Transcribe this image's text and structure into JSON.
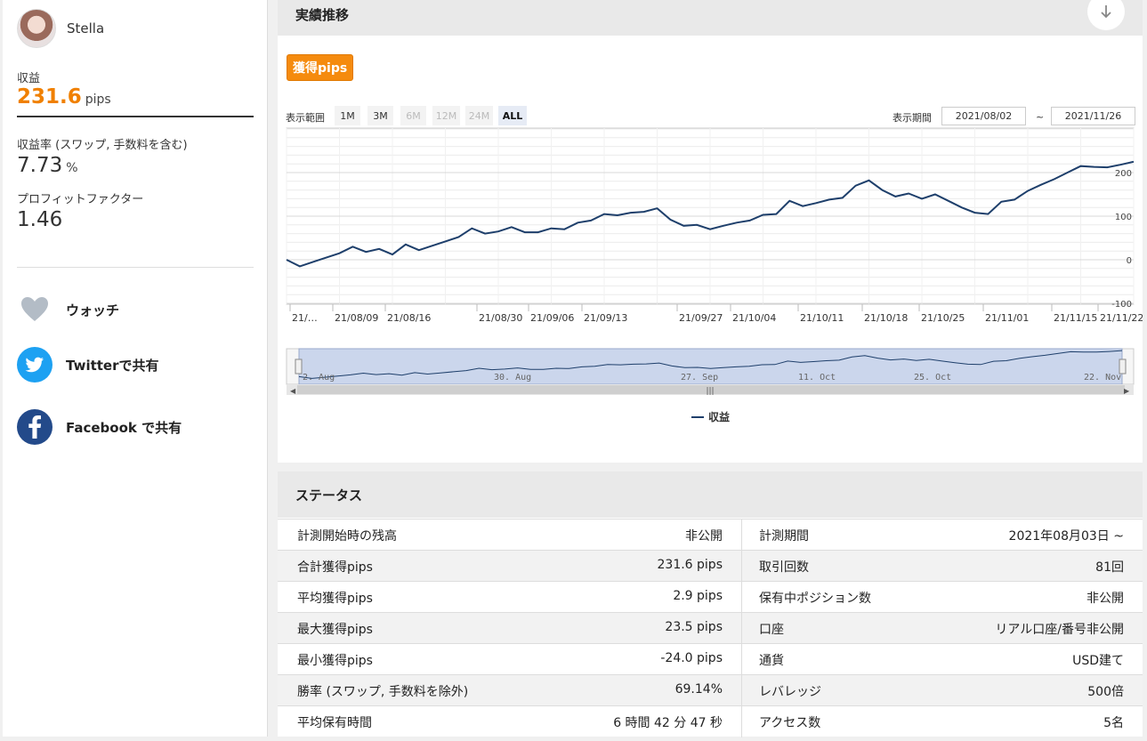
{
  "profile": {
    "name": "Stella"
  },
  "metrics": {
    "profit_label": "収益",
    "profit_value": "231.6",
    "profit_unit": "pips",
    "rate_label": "収益率 (スワップ, 手数料を含む)",
    "rate_value": "7.73",
    "rate_unit": "%",
    "pf_label": "プロフィットファクター",
    "pf_value": "1.46"
  },
  "share": {
    "watch": "ウォッチ",
    "twitter": "Twitterで共有",
    "facebook": "Facebook で共有"
  },
  "performance": {
    "title": "実績推移",
    "badge": "獲得pips"
  },
  "range": {
    "label": "表示範囲",
    "buttons": [
      "1M",
      "3M",
      "6M",
      "12M",
      "24M",
      "ALL"
    ],
    "period_label": "表示期間",
    "from": "2021/08/02",
    "tilde": "~",
    "to": "2021/11/26"
  },
  "colors": {
    "line": "#1e3f6b",
    "accent": "#f08000",
    "navigator": "#cbd6ec"
  },
  "chart_data": {
    "type": "line",
    "series": [
      {
        "name": "収益",
        "values": [
          0,
          -15,
          -5,
          5,
          15,
          30,
          18,
          25,
          12,
          35,
          22,
          32,
          42,
          52,
          72,
          60,
          65,
          75,
          63,
          63,
          72,
          70,
          85,
          90,
          105,
          102,
          108,
          110,
          118,
          92,
          78,
          80,
          70,
          78,
          85,
          90,
          103,
          105,
          135,
          123,
          130,
          138,
          142,
          170,
          182,
          160,
          145,
          152,
          140,
          150,
          135,
          120,
          108,
          105,
          133,
          138,
          158,
          172,
          185,
          200,
          215,
          213,
          212,
          218,
          225
        ]
      }
    ],
    "x_tick_labels": [
      "21/…",
      "21/08/09",
      "21/08/16",
      "21/08/30",
      "21/09/06",
      "21/09/13",
      "21/09/27",
      "21/10/04",
      "21/10/11",
      "21/10/18",
      "21/10/25",
      "21/11/01",
      "21/11/15",
      "21/11/22"
    ],
    "y_ticks": [
      200,
      100,
      0,
      -100
    ],
    "ylim": [
      -110,
      300
    ],
    "legend": "bottom-center",
    "navigator_labels": [
      "2. Aug",
      "30. Aug",
      "27. Sep",
      "11. Oct",
      "25. Oct",
      "22. Nov"
    ],
    "grid": true
  },
  "status": {
    "title": "ステータス",
    "rows": [
      {
        "left_label": "計測開始時の残高",
        "left_value": "非公開",
        "right_label": "計測期間",
        "right_value": "2021年08月03日 ~"
      },
      {
        "left_label": "合計獲得pips",
        "left_value": "231.6 pips",
        "right_label": "取引回数",
        "right_value": "81回"
      },
      {
        "left_label": "平均獲得pips",
        "left_value": "2.9 pips",
        "right_label": "保有中ポジション数",
        "right_value": "非公開"
      },
      {
        "left_label": "最大獲得pips",
        "left_value": "23.5 pips",
        "right_label": "口座",
        "right_value": "リアル口座/番号非公開"
      },
      {
        "left_label": "最小獲得pips",
        "left_value": "-24.0 pips",
        "right_label": "通貨",
        "right_value": "USD建て"
      },
      {
        "left_label": "勝率 (スワップ, 手数料を除外)",
        "left_value": "69.14%",
        "right_label": "レバレッジ",
        "right_value": "500倍"
      },
      {
        "left_label": "平均保有時間",
        "left_value": "6 時間 42 分 47 秒",
        "right_label": "アクセス数",
        "right_value": "5名"
      }
    ]
  }
}
